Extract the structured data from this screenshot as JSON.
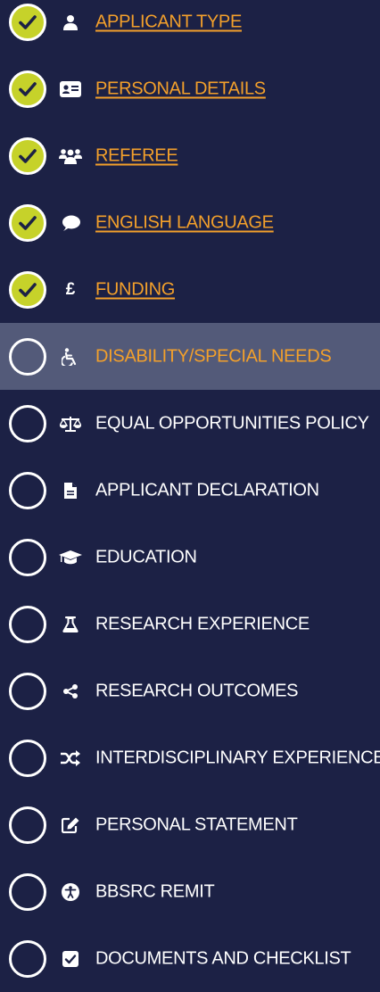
{
  "steps": [
    {
      "label": "APPLICANT TYPE",
      "icon": "user-icon",
      "status": "complete"
    },
    {
      "label": "PERSONAL DETAILS",
      "icon": "id-card-icon",
      "status": "complete"
    },
    {
      "label": "REFEREE",
      "icon": "users-icon",
      "status": "complete"
    },
    {
      "label": "ENGLISH LANGUAGE",
      "icon": "comment-icon",
      "status": "complete"
    },
    {
      "label": "FUNDING",
      "icon": "pound-icon",
      "status": "complete",
      "symbol": "£"
    },
    {
      "label": "DISABILITY/SPECIAL NEEDS",
      "icon": "wheelchair-icon",
      "status": "current"
    },
    {
      "label": "EQUAL OPPORTUNITIES POLICY",
      "icon": "balance-scale-icon",
      "status": "incomplete"
    },
    {
      "label": "APPLICANT DECLARATION",
      "icon": "file-icon",
      "status": "incomplete"
    },
    {
      "label": "EDUCATION",
      "icon": "graduation-cap-icon",
      "status": "incomplete"
    },
    {
      "label": "RESEARCH EXPERIENCE",
      "icon": "flask-icon",
      "status": "incomplete"
    },
    {
      "label": "RESEARCH OUTCOMES",
      "icon": "share-nodes-icon",
      "status": "incomplete"
    },
    {
      "label": "INTERDISCIPLINARY EXPERIENCE",
      "icon": "shuffle-icon",
      "status": "incomplete"
    },
    {
      "label": "PERSONAL STATEMENT",
      "icon": "edit-icon",
      "status": "incomplete"
    },
    {
      "label": "BBSRC REMIT",
      "icon": "accessibility-icon",
      "status": "incomplete"
    },
    {
      "label": "DOCUMENTS AND CHECKLIST",
      "icon": "check-square-icon",
      "status": "incomplete"
    }
  ],
  "colors": {
    "background": "#1c2145",
    "active_row": "#535a79",
    "complete_fill": "#c6d22a",
    "link_text": "#f3a02b",
    "default_text": "#ffffff"
  }
}
